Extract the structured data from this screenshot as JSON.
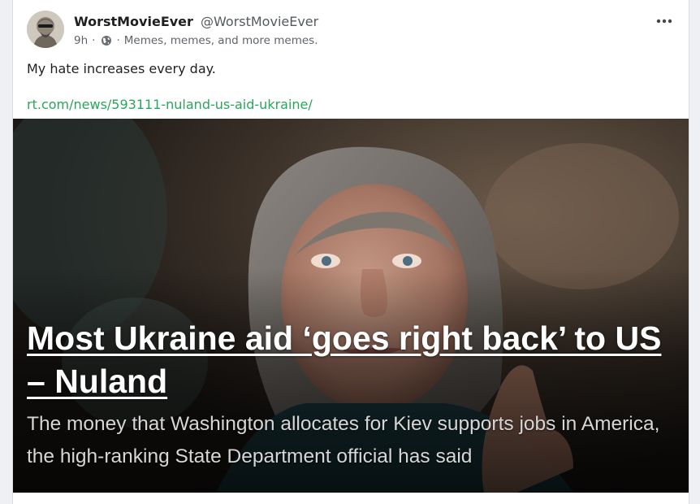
{
  "post": {
    "display_name": "WorstMovieEver",
    "handle": "@WorstMovieEver",
    "time": "9h",
    "separator": "·",
    "visibility_icon": "globe-icon",
    "description": "Memes, memes, and more memes.",
    "body_text": "My hate increases every day.",
    "link": "rt.com/news/593111-nuland-us-aid-ukraine/",
    "more_icon": "more-dots-icon"
  },
  "media": {
    "headline": "Most Ukraine aid ‘goes right back’ to US – Nuland",
    "subheadline": "The money that Washington allocates for Kiev supports jobs in America, the high-ranking State Department official has said"
  },
  "colors": {
    "link": "#2aa55b",
    "card_background": "#ffffff",
    "page_background": "#eef0f4"
  }
}
